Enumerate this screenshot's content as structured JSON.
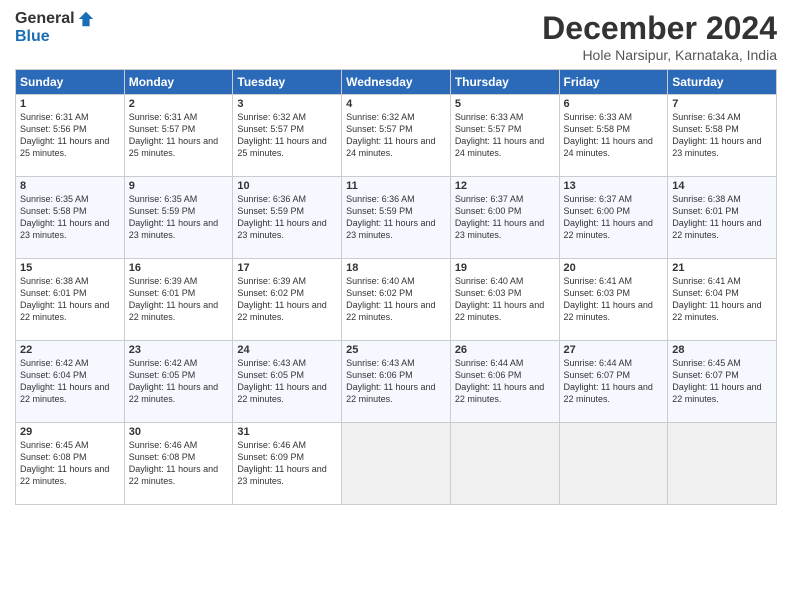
{
  "logo": {
    "general": "General",
    "blue": "Blue"
  },
  "title": "December 2024",
  "location": "Hole Narsipur, Karnataka, India",
  "weekdays": [
    "Sunday",
    "Monday",
    "Tuesday",
    "Wednesday",
    "Thursday",
    "Friday",
    "Saturday"
  ],
  "weeks": [
    [
      {
        "day": "1",
        "sunrise": "6:31 AM",
        "sunset": "5:56 PM",
        "daylight": "11 hours and 25 minutes."
      },
      {
        "day": "2",
        "sunrise": "6:31 AM",
        "sunset": "5:57 PM",
        "daylight": "11 hours and 25 minutes."
      },
      {
        "day": "3",
        "sunrise": "6:32 AM",
        "sunset": "5:57 PM",
        "daylight": "11 hours and 25 minutes."
      },
      {
        "day": "4",
        "sunrise": "6:32 AM",
        "sunset": "5:57 PM",
        "daylight": "11 hours and 24 minutes."
      },
      {
        "day": "5",
        "sunrise": "6:33 AM",
        "sunset": "5:57 PM",
        "daylight": "11 hours and 24 minutes."
      },
      {
        "day": "6",
        "sunrise": "6:33 AM",
        "sunset": "5:58 PM",
        "daylight": "11 hours and 24 minutes."
      },
      {
        "day": "7",
        "sunrise": "6:34 AM",
        "sunset": "5:58 PM",
        "daylight": "11 hours and 23 minutes."
      }
    ],
    [
      {
        "day": "8",
        "sunrise": "6:35 AM",
        "sunset": "5:58 PM",
        "daylight": "11 hours and 23 minutes."
      },
      {
        "day": "9",
        "sunrise": "6:35 AM",
        "sunset": "5:59 PM",
        "daylight": "11 hours and 23 minutes."
      },
      {
        "day": "10",
        "sunrise": "6:36 AM",
        "sunset": "5:59 PM",
        "daylight": "11 hours and 23 minutes."
      },
      {
        "day": "11",
        "sunrise": "6:36 AM",
        "sunset": "5:59 PM",
        "daylight": "11 hours and 23 minutes."
      },
      {
        "day": "12",
        "sunrise": "6:37 AM",
        "sunset": "6:00 PM",
        "daylight": "11 hours and 23 minutes."
      },
      {
        "day": "13",
        "sunrise": "6:37 AM",
        "sunset": "6:00 PM",
        "daylight": "11 hours and 22 minutes."
      },
      {
        "day": "14",
        "sunrise": "6:38 AM",
        "sunset": "6:01 PM",
        "daylight": "11 hours and 22 minutes."
      }
    ],
    [
      {
        "day": "15",
        "sunrise": "6:38 AM",
        "sunset": "6:01 PM",
        "daylight": "11 hours and 22 minutes."
      },
      {
        "day": "16",
        "sunrise": "6:39 AM",
        "sunset": "6:01 PM",
        "daylight": "11 hours and 22 minutes."
      },
      {
        "day": "17",
        "sunrise": "6:39 AM",
        "sunset": "6:02 PM",
        "daylight": "11 hours and 22 minutes."
      },
      {
        "day": "18",
        "sunrise": "6:40 AM",
        "sunset": "6:02 PM",
        "daylight": "11 hours and 22 minutes."
      },
      {
        "day": "19",
        "sunrise": "6:40 AM",
        "sunset": "6:03 PM",
        "daylight": "11 hours and 22 minutes."
      },
      {
        "day": "20",
        "sunrise": "6:41 AM",
        "sunset": "6:03 PM",
        "daylight": "11 hours and 22 minutes."
      },
      {
        "day": "21",
        "sunrise": "6:41 AM",
        "sunset": "6:04 PM",
        "daylight": "11 hours and 22 minutes."
      }
    ],
    [
      {
        "day": "22",
        "sunrise": "6:42 AM",
        "sunset": "6:04 PM",
        "daylight": "11 hours and 22 minutes."
      },
      {
        "day": "23",
        "sunrise": "6:42 AM",
        "sunset": "6:05 PM",
        "daylight": "11 hours and 22 minutes."
      },
      {
        "day": "24",
        "sunrise": "6:43 AM",
        "sunset": "6:05 PM",
        "daylight": "11 hours and 22 minutes."
      },
      {
        "day": "25",
        "sunrise": "6:43 AM",
        "sunset": "6:06 PM",
        "daylight": "11 hours and 22 minutes."
      },
      {
        "day": "26",
        "sunrise": "6:44 AM",
        "sunset": "6:06 PM",
        "daylight": "11 hours and 22 minutes."
      },
      {
        "day": "27",
        "sunrise": "6:44 AM",
        "sunset": "6:07 PM",
        "daylight": "11 hours and 22 minutes."
      },
      {
        "day": "28",
        "sunrise": "6:45 AM",
        "sunset": "6:07 PM",
        "daylight": "11 hours and 22 minutes."
      }
    ],
    [
      {
        "day": "29",
        "sunrise": "6:45 AM",
        "sunset": "6:08 PM",
        "daylight": "11 hours and 22 minutes."
      },
      {
        "day": "30",
        "sunrise": "6:46 AM",
        "sunset": "6:08 PM",
        "daylight": "11 hours and 22 minutes."
      },
      {
        "day": "31",
        "sunrise": "6:46 AM",
        "sunset": "6:09 PM",
        "daylight": "11 hours and 23 minutes."
      },
      null,
      null,
      null,
      null
    ]
  ]
}
